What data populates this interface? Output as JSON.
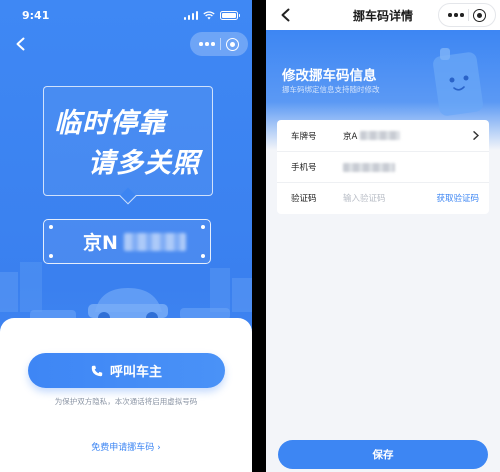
{
  "left_screen": {
    "status_time": "9:41",
    "sign": {
      "line1": "临时停靠",
      "line2": "请多关照"
    },
    "plate_prefix": "京N",
    "call_button_label": "呼叫车主",
    "privacy_note": "为保护双方隐私，本次通话将启用虚拟号码",
    "apply_link": "免费申请挪车码 ›"
  },
  "right_screen": {
    "nav_title": "挪车码详情",
    "hero": {
      "title": "修改挪车码信息",
      "subtitle": "挪车码绑定信息支持随时修改"
    },
    "form": {
      "plate_label": "车牌号",
      "plate_value": "京A",
      "phone_label": "手机号",
      "code_label": "验证码",
      "code_placeholder": "输入验证码",
      "get_code_label": "获取验证码"
    },
    "save_label": "保存"
  },
  "colors": {
    "brand_blue": "#3d86f3",
    "page_bg": "#f3f5f9",
    "hint_gray": "#8b95a5"
  },
  "icons": [
    "back-icon",
    "more-dots-icon",
    "target-icon",
    "phone-icon",
    "chevron-right-icon",
    "signal-icon",
    "wifi-icon",
    "battery-icon"
  ]
}
